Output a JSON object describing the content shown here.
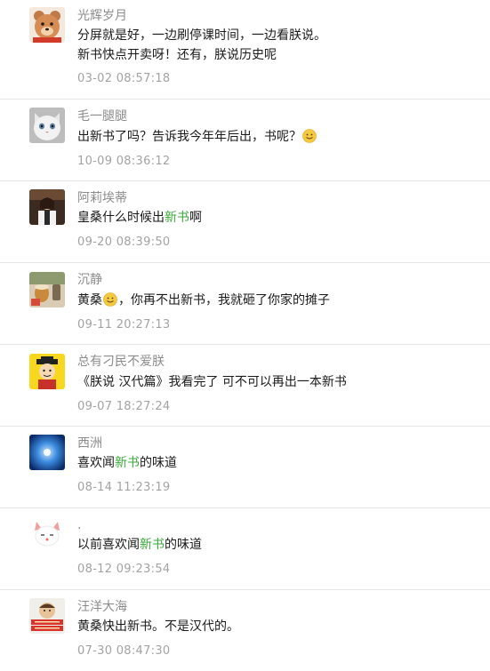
{
  "comments": [
    {
      "name": "光辉岁月",
      "line1": "分屏就是好，一边刷停课时间，一边看朕说。",
      "line2": "新书快点开卖呀！还有，朕说历史呢",
      "time": "03-02 08:57:18"
    },
    {
      "name": "毛一腿腿",
      "line1": "出新书了吗？告诉我今年年后出，书呢？",
      "emoji": "smile-emoji",
      "time": "10-09 08:36:12"
    },
    {
      "name": "阿莉埃蒂",
      "pre": "皇桑什么时候出",
      "hl": "新书",
      "post": "啊",
      "time": "09-20 08:39:50"
    },
    {
      "name": "沉静",
      "pre": "黄桑",
      "emoji": "smile-emoji",
      "post": "，你再不出新书，我就砸了你家的摊子",
      "time": "09-11 20:27:13"
    },
    {
      "name": "总有刁民不爱朕",
      "line1": "《朕说 汉代篇》我看完了 可不可以再出一本新书",
      "time": "09-07 18:27:24"
    },
    {
      "name": "西洲",
      "pre": "喜欢闻",
      "hl": "新书",
      "post": "的味道",
      "time": "08-14 11:23:19"
    },
    {
      "name": ".",
      "pre": "以前喜欢闻",
      "hl": "新书",
      "post": "的味道",
      "time": "08-12 09:23:54"
    },
    {
      "name": "汪洋大海",
      "line1": "黄桑快出新书。不是汉代的。",
      "time": "07-30 08:47:30"
    }
  ],
  "colors": {
    "name": "#8c8c8c",
    "text": "#1a1a1a",
    "time": "#a3a3a3",
    "highlight": "#3aa93a",
    "divider": "#e6e6e6"
  }
}
